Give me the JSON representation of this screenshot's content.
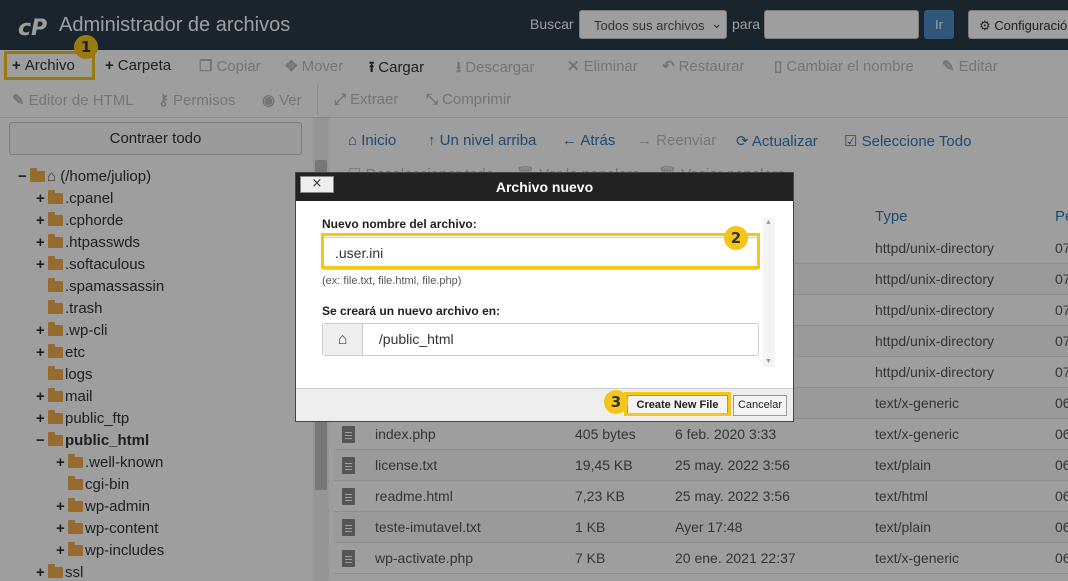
{
  "header": {
    "title": "Administrador de archivos",
    "search_label": "Buscar",
    "search_scope": "Todos sus archivos",
    "para_label": "para",
    "search_placeholder": "",
    "go_label": "Ir",
    "config_label": "Configuración"
  },
  "toolbar": {
    "row1": [
      {
        "label": "Archivo",
        "icon": "plus-icon",
        "enabled": true
      },
      {
        "label": "Carpeta",
        "icon": "plus-icon",
        "enabled": true
      },
      {
        "label": "Copiar",
        "icon": "copy-icon",
        "enabled": false
      },
      {
        "label": "Mover",
        "icon": "move-icon",
        "enabled": false
      },
      {
        "label": "Cargar",
        "icon": "upload-icon",
        "enabled": true
      },
      {
        "label": "Descargar",
        "icon": "download-icon",
        "enabled": false
      },
      {
        "label": "Eliminar",
        "icon": "close-icon",
        "enabled": false
      },
      {
        "label": "Restaurar",
        "icon": "undo-icon",
        "enabled": false
      },
      {
        "label": "Cambiar el nombre",
        "icon": "file-icon",
        "enabled": false
      },
      {
        "label": "Editar",
        "icon": "pencil-icon",
        "enabled": false
      }
    ],
    "row2": [
      {
        "label": "Editor de HTML",
        "icon": "edit-icon",
        "enabled": false
      },
      {
        "label": "Permisos",
        "icon": "key-icon",
        "enabled": false
      },
      {
        "label": "Ver",
        "icon": "eye-icon",
        "enabled": false
      },
      {
        "label": "Extraer",
        "icon": "expand-icon",
        "enabled": false
      },
      {
        "label": "Comprimir",
        "icon": "compress-icon",
        "enabled": false
      }
    ]
  },
  "badges": [
    "1",
    "2",
    "3"
  ],
  "sidebar": {
    "collapse_label": "Contraer todo",
    "root": "(/home/juliop)",
    "items": [
      {
        "label": ".cpanel",
        "pm": "+"
      },
      {
        "label": ".cphorde",
        "pm": "+"
      },
      {
        "label": ".htpasswds",
        "pm": "+"
      },
      {
        "label": ".softaculous",
        "pm": "+"
      },
      {
        "label": ".spamassassin",
        "pm": ""
      },
      {
        "label": ".trash",
        "pm": ""
      },
      {
        "label": ".wp-cli",
        "pm": "+"
      },
      {
        "label": "etc",
        "pm": "+"
      },
      {
        "label": "logs",
        "pm": ""
      },
      {
        "label": "mail",
        "pm": "+"
      },
      {
        "label": "public_ftp",
        "pm": "+"
      },
      {
        "label": "public_html",
        "pm": "−"
      },
      {
        "label": ".well-known",
        "pm": "+"
      },
      {
        "label": "cgi-bin",
        "pm": ""
      },
      {
        "label": "wp-admin",
        "pm": "+"
      },
      {
        "label": "wp-content",
        "pm": "+"
      },
      {
        "label": "wp-includes",
        "pm": "+"
      },
      {
        "label": "ssl",
        "pm": "+"
      }
    ]
  },
  "nav": {
    "row1": [
      "Inicio",
      "Un nivel arriba",
      "Atrás",
      "Reenviar",
      "Actualizar",
      "Seleccione Todo"
    ],
    "row2": [
      "Deseleccionar todo",
      "Ver la papelera",
      "Vaciar papelera"
    ]
  },
  "table": {
    "headers": {
      "type": "Type",
      "perm": "Pe"
    },
    "rows": [
      {
        "name": "",
        "size": "",
        "date": "",
        "type": "httpd/unix-directory",
        "perm": "07",
        "icon": "folder-icon"
      },
      {
        "name": "",
        "size": "",
        "date": "",
        "type": "httpd/unix-directory",
        "perm": "07",
        "icon": "folder-icon"
      },
      {
        "name": "",
        "size": "",
        "date": "",
        "type": "httpd/unix-directory",
        "perm": "07",
        "icon": "folder-icon"
      },
      {
        "name": "",
        "size": "",
        "date": "",
        "type": "httpd/unix-directory",
        "perm": "07",
        "icon": "folder-icon"
      },
      {
        "name": "",
        "size": "",
        "date": "",
        "type": "httpd/unix-directory",
        "perm": "07",
        "icon": "folder-icon"
      },
      {
        "name": "",
        "size": "",
        "date": "",
        "type": "text/x-generic",
        "perm": "06",
        "icon": "file-icon"
      },
      {
        "name": "index.php",
        "size": "405 bytes",
        "date": "6 feb. 2020 3:33",
        "type": "text/x-generic",
        "perm": "06",
        "icon": "file-icon"
      },
      {
        "name": "license.txt",
        "size": "19,45 KB",
        "date": "25 may. 2022 3:56",
        "type": "text/plain",
        "perm": "06",
        "icon": "file-icon"
      },
      {
        "name": "readme.html",
        "size": "7,23 KB",
        "date": "25 may. 2022 3:56",
        "type": "text/html",
        "perm": "06",
        "icon": "html-file-icon"
      },
      {
        "name": "teste-imutavel.txt",
        "size": "1 KB",
        "date": "Ayer 17:48",
        "type": "text/plain",
        "perm": "06",
        "icon": "file-icon"
      },
      {
        "name": "wp-activate.php",
        "size": "7 KB",
        "date": "20 ene. 2021 22:37",
        "type": "text/x-generic",
        "perm": "06",
        "icon": "file-icon"
      }
    ]
  },
  "dialog": {
    "title": "Archivo nuevo",
    "close_label": "×",
    "filename_label": "Nuevo nombre del archivo:",
    "filename_value": ".user.ini",
    "filename_hint": "(ex: file.txt, file.html, file.php)",
    "location_label": "Se creará un nuevo archivo en:",
    "location_value": "/public_html",
    "create_label": "Create New File",
    "cancel_label": "Cancelar"
  },
  "colors": {
    "header_bg": "#293a4a",
    "highlight": "#f5c518",
    "link": "#337ab7",
    "folder": "#f0ad4e"
  }
}
